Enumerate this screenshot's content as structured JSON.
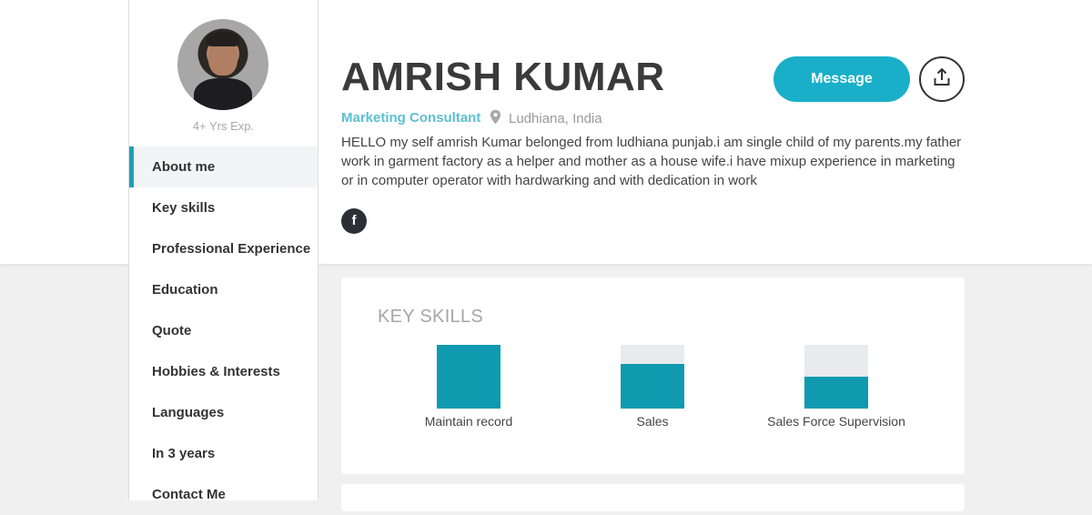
{
  "profile": {
    "name": "AMRISH KUMAR",
    "role": "Marketing Consultant",
    "location": "Ludhiana, India",
    "experience": "4+ Yrs Exp.",
    "about": "HELLO my self amrish Kumar belonged from ludhiana punjab.i am single child of my parents.my father work in garment factory as a helper and mother as a house wife.i have mixup experience in marketing or in computer operator with hardwarking and with dedication in work",
    "social_icon": "f"
  },
  "actions": {
    "message_label": "Message",
    "share_icon": "share-icon"
  },
  "nav": {
    "items": [
      {
        "label": "About me"
      },
      {
        "label": "Key skills"
      },
      {
        "label": "Professional Experience"
      },
      {
        "label": "Education"
      },
      {
        "label": "Quote"
      },
      {
        "label": "Hobbies & Interests"
      },
      {
        "label": "Languages"
      },
      {
        "label": "In 3 years"
      },
      {
        "label": "Contact Me"
      }
    ],
    "active_index": 0
  },
  "skills": {
    "title": "KEY SKILLS",
    "items": [
      {
        "label": "Maintain record",
        "level": 1.0
      },
      {
        "label": "Sales",
        "level": 0.7
      },
      {
        "label": "Sales Force Supervision",
        "level": 0.5
      }
    ]
  },
  "colors": {
    "accent": "#1aafc8",
    "bar_fill": "#0f9aaf",
    "role_text": "#5cc0cf"
  }
}
